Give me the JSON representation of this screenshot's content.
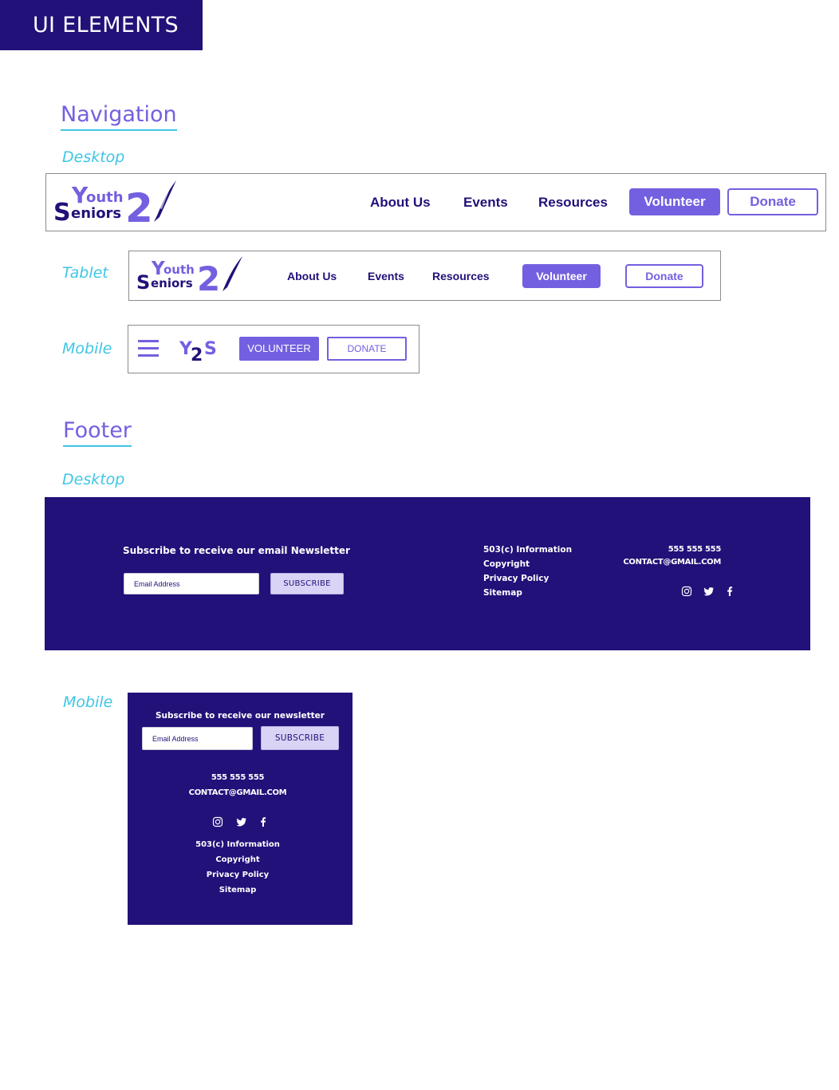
{
  "page": {
    "badge": "UI ELEMENTS"
  },
  "navigation": {
    "title": "Navigation",
    "desktop_label": "Desktop",
    "tablet_label": "Tablet",
    "mobile_label": "Mobile",
    "logo": {
      "youth": "outh",
      "youth_initial": "Y",
      "seniors_initial": "S",
      "seniors": "eniors",
      "numeral": "2",
      "short": {
        "y": "Y",
        "two": "2",
        "s": "S"
      }
    },
    "links": {
      "about": "About Us",
      "events": "Events",
      "resources": "Resources"
    },
    "volunteer": "Volunteer",
    "donate": "Donate",
    "mobile_volunteer": "VOLUNTEER",
    "mobile_donate": "DONATE"
  },
  "footer": {
    "title": "Footer",
    "desktop_label": "Desktop",
    "mobile_label": "Mobile",
    "newsletter_desktop": "Subscribe to receive our email Newsletter",
    "newsletter_mobile": "Subscribe to receive our newsletter",
    "email_placeholder": "Email Address",
    "subscribe": "SUBSCRIBE",
    "links": [
      "503(c) Information",
      "Copyright",
      "Privacy Policy",
      "Sitemap"
    ],
    "phone": "555 555 555",
    "email": "CONTACT@GMAIL.COM",
    "social_icons": [
      "instagram-icon",
      "twitter-icon",
      "facebook-icon"
    ]
  },
  "colors": {
    "brand_dark": "#211179",
    "brand_accent": "#7360e0",
    "label_cyan": "#3ec6e6",
    "subscribe_bg": "#d9d4f5"
  }
}
